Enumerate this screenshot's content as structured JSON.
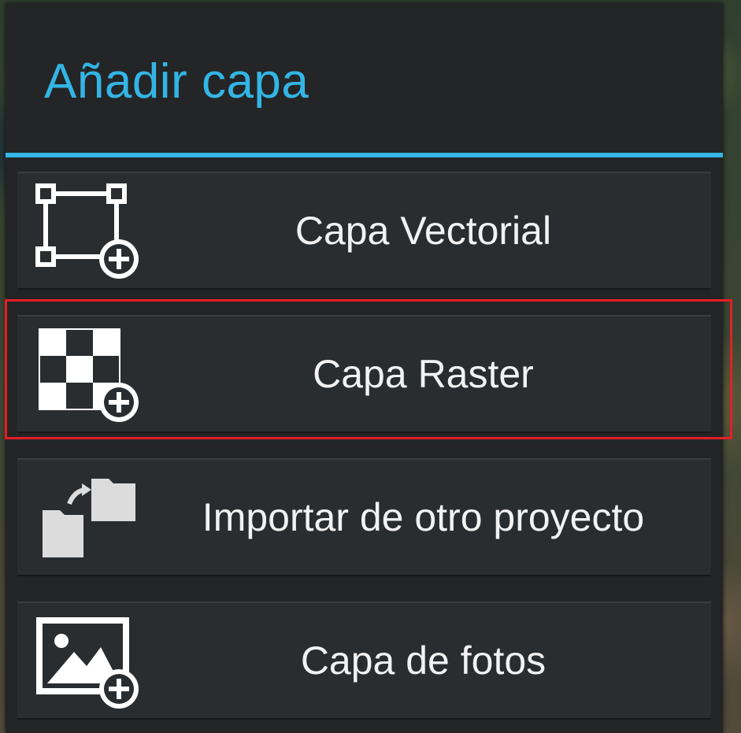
{
  "dialog": {
    "title": "Añadir capa"
  },
  "options": [
    {
      "label": "Capa Vectorial",
      "icon": "vector-layer-add-icon"
    },
    {
      "label": "Capa Raster",
      "icon": "raster-layer-add-icon",
      "highlighted": true
    },
    {
      "label": "Importar de otro proyecto",
      "icon": "import-folder-icon"
    },
    {
      "label": "Capa de fotos",
      "icon": "photo-layer-add-icon"
    }
  ],
  "colors": {
    "accent": "#33b5e5",
    "dialog_bg": "#232426",
    "option_bg": "#2a2d30",
    "text": "#f2f2f2",
    "highlight": "#e41e26"
  }
}
